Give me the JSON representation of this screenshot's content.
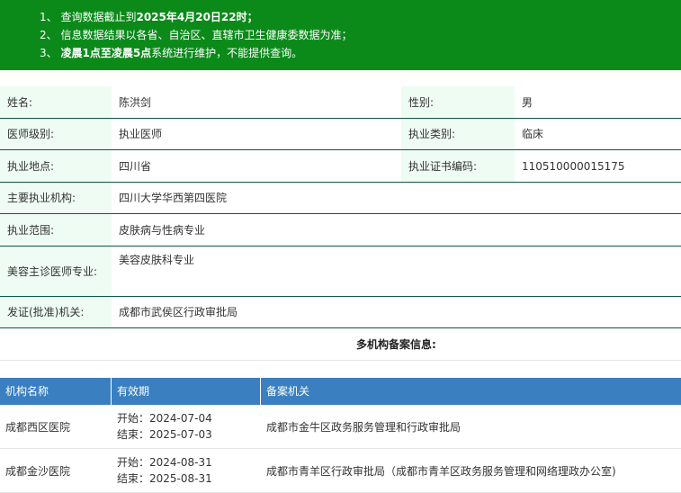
{
  "notice": {
    "items": [
      {
        "num": "1、",
        "parts": [
          {
            "t": "查询数据截止到",
            "b": false
          },
          {
            "t": "2025年4月20日22时",
            "b": true
          },
          {
            "t": "；",
            "b": false
          }
        ]
      },
      {
        "num": "2、",
        "parts": [
          {
            "t": "信息数据结果以各省、自治区、直辖市卫生健康委数据为准；",
            "b": false
          }
        ]
      },
      {
        "num": "3、",
        "parts": [
          {
            "t": "凌晨1点至凌晨5点",
            "b": true
          },
          {
            "t": "系统进行维护，不能提供查询。",
            "b": false
          }
        ]
      }
    ]
  },
  "info": {
    "name_label": "姓名:",
    "name": "陈洪剑",
    "gender_label": "性别:",
    "gender": "男",
    "level_label": "医师级别:",
    "level": "执业医师",
    "category_label": "执业类别:",
    "category": "临床",
    "location_label": "执业地点:",
    "location": "四川省",
    "cert_label": "执业证书编码:",
    "cert": "110510000015175",
    "org_label": "主要执业机构:",
    "org": "四川大学华西第四医院",
    "scope_label": "执业范围:",
    "scope": "皮肤病与性病专业",
    "cosmetic_label": "美容主诊医师专业:",
    "cosmetic": "美容皮肤科专业",
    "issuer_label": "发证(批准)机关:",
    "issuer": "成都市武侯区行政审批局"
  },
  "multi_title": "多机构备案信息:",
  "table": {
    "headers": [
      "机构名称",
      "有效期",
      "备案机关"
    ],
    "rows": [
      {
        "name": "成都西区医院",
        "start": "开始：2024-07-04",
        "end": "结束：2025-07-03",
        "authority": "成都市金牛区政务服务管理和行政审批局"
      },
      {
        "name": "成都金沙医院",
        "start": "开始：2024-08-31",
        "end": "结束：2025-08-31",
        "authority": "成都市青羊区行政审批局（成都市青羊区政务服务管理和网络理政办公室)"
      }
    ]
  }
}
